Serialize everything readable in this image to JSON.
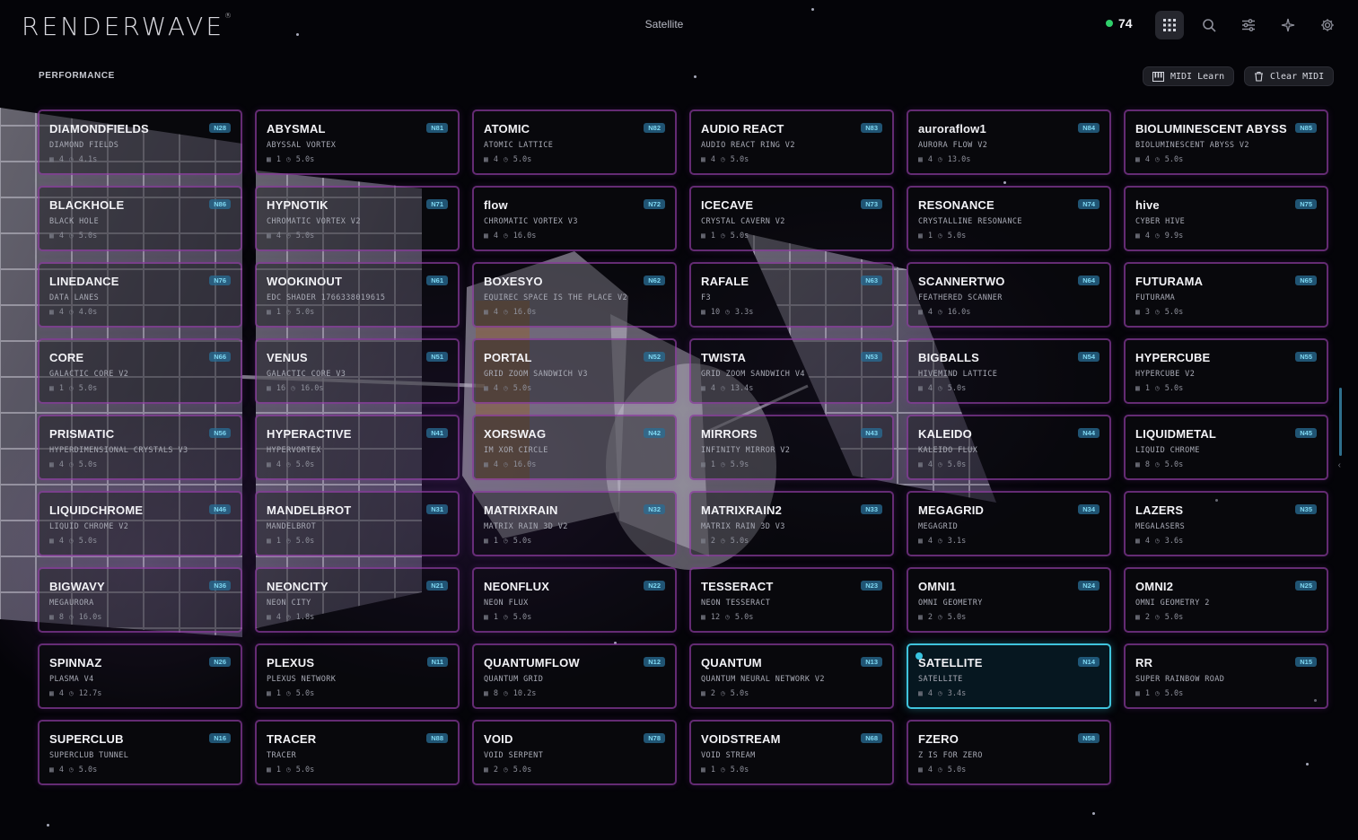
{
  "app": {
    "logo": "RENDERWAVE",
    "logo_mark": "®",
    "title": "Satellite"
  },
  "header": {
    "fps_value": "74",
    "fps_color": "#2fcf6a",
    "icons": [
      "grid-icon",
      "search-icon",
      "sliders-icon",
      "sparkle-icon",
      "gear-icon"
    ]
  },
  "performance": {
    "label": "PERFORMANCE",
    "midi_learn_label": "MIDI Learn",
    "clear_midi_label": "Clear MIDI"
  },
  "colors": {
    "card_border": "#b048c8",
    "selected_border": "#3fc3dc",
    "badge_text": "#7fd8f2"
  },
  "presets": [
    {
      "name": "DIAMONDFIELDS",
      "sub": "DIAMOND FIELDS",
      "layers": "4",
      "duration": "4.1s",
      "badge": "N28"
    },
    {
      "name": "ABYSMAL",
      "sub": "ABYSSAL VORTEX",
      "layers": "1",
      "duration": "5.0s",
      "badge": "N81"
    },
    {
      "name": "ATOMIC",
      "sub": "ATOMIC LATTICE",
      "layers": "4",
      "duration": "5.0s",
      "badge": "N82"
    },
    {
      "name": "AUDIO REACT",
      "sub": "AUDIO REACT RING V2",
      "layers": "4",
      "duration": "5.0s",
      "badge": "N83"
    },
    {
      "name": "auroraflow1",
      "sub": "AURORA FLOW V2",
      "layers": "4",
      "duration": "13.0s",
      "badge": "N84"
    },
    {
      "name": "BIOLUMINESCENT ABYSS",
      "sub": "BIOLUMINESCENT ABYSS V2",
      "layers": "4",
      "duration": "5.0s",
      "badge": "N85"
    },
    {
      "name": "BLACKHOLE",
      "sub": "BLACK HOLE",
      "layers": "4",
      "duration": "5.0s",
      "badge": "N86"
    },
    {
      "name": "HYPNOTIK",
      "sub": "CHROMATIC VORTEX V2",
      "layers": "4",
      "duration": "5.0s",
      "badge": "N71"
    },
    {
      "name": "flow",
      "sub": "CHROMATIC VORTEX V3",
      "layers": "4",
      "duration": "16.0s",
      "badge": "N72"
    },
    {
      "name": "ICECAVE",
      "sub": "CRYSTAL CAVERN V2",
      "layers": "1",
      "duration": "5.0s",
      "badge": "N73"
    },
    {
      "name": "RESONANCE",
      "sub": "CRYSTALLINE RESONANCE",
      "layers": "1",
      "duration": "5.0s",
      "badge": "N74"
    },
    {
      "name": "hive",
      "sub": "CYBER HIVE",
      "layers": "4",
      "duration": "9.9s",
      "badge": "N75"
    },
    {
      "name": "LINEDANCE",
      "sub": "DATA LANES",
      "layers": "4",
      "duration": "4.0s",
      "badge": "N76"
    },
    {
      "name": "WOOKINOUT",
      "sub": "EDC SHADER 1766338019615",
      "layers": "1",
      "duration": "5.0s",
      "badge": "N61"
    },
    {
      "name": "BOXESYO",
      "sub": "EQUIREC SPACE IS THE PLACE V2",
      "layers": "4",
      "duration": "16.0s",
      "badge": "N62"
    },
    {
      "name": "RAFALE",
      "sub": "F3",
      "layers": "10",
      "duration": "3.3s",
      "badge": "N63"
    },
    {
      "name": "SCANNERTWO",
      "sub": "FEATHERED SCANNER",
      "layers": "4",
      "duration": "16.0s",
      "badge": "N64"
    },
    {
      "name": "FUTURAMA",
      "sub": "FUTURAMA",
      "layers": "3",
      "duration": "5.0s",
      "badge": "N65"
    },
    {
      "name": "CORE",
      "sub": "GALACTIC CORE V2",
      "layers": "1",
      "duration": "5.0s",
      "badge": "N66"
    },
    {
      "name": "VENUS",
      "sub": "GALACTIC CORE V3",
      "layers": "16",
      "duration": "16.0s",
      "badge": "N51"
    },
    {
      "name": "PORTAL",
      "sub": "GRID ZOOM SANDWICH V3",
      "layers": "4",
      "duration": "5.0s",
      "badge": "N52"
    },
    {
      "name": "TWISTA",
      "sub": "GRID ZOOM SANDWICH V4",
      "layers": "4",
      "duration": "13.4s",
      "badge": "N53"
    },
    {
      "name": "BIGBALLS",
      "sub": "HIVEMIND LATTICE",
      "layers": "4",
      "duration": "5.0s",
      "badge": "N54"
    },
    {
      "name": "HYPERCUBE",
      "sub": "HYPERCUBE V2",
      "layers": "1",
      "duration": "5.0s",
      "badge": "N55"
    },
    {
      "name": "PRISMATIC",
      "sub": "HYPERDIMENSIONAL CRYSTALS V3",
      "layers": "4",
      "duration": "5.0s",
      "badge": "N56"
    },
    {
      "name": "HYPERACTIVE",
      "sub": "HYPERVORTEX",
      "layers": "4",
      "duration": "5.0s",
      "badge": "N41"
    },
    {
      "name": "XORSWAG",
      "sub": "IM XOR CIRCLE",
      "layers": "4",
      "duration": "16.0s",
      "badge": "N42"
    },
    {
      "name": "MIRRORS",
      "sub": "INFINITY MIRROR V2",
      "layers": "1",
      "duration": "5.9s",
      "badge": "N43"
    },
    {
      "name": "KALEIDO",
      "sub": "KALEIDO FLUX",
      "layers": "4",
      "duration": "5.0s",
      "badge": "N44"
    },
    {
      "name": "LIQUIDMETAL",
      "sub": "LIQUID CHROME",
      "layers": "8",
      "duration": "5.0s",
      "badge": "N45"
    },
    {
      "name": "LIQUIDCHROME",
      "sub": "LIQUID CHROME V2",
      "layers": "4",
      "duration": "5.0s",
      "badge": "N46"
    },
    {
      "name": "MANDELBROT",
      "sub": "MANDELBROT",
      "layers": "1",
      "duration": "5.0s",
      "badge": "N31"
    },
    {
      "name": "MATRIXRAIN",
      "sub": "MATRIX RAIN 3D V2",
      "layers": "1",
      "duration": "5.0s",
      "badge": "N32"
    },
    {
      "name": "MATRIXRAIN2",
      "sub": "MATRIX RAIN 3D V3",
      "layers": "2",
      "duration": "5.0s",
      "badge": "N33"
    },
    {
      "name": "MEGAGRID",
      "sub": "MEGAGRID",
      "layers": "4",
      "duration": "3.1s",
      "badge": "N34"
    },
    {
      "name": "LAZERS",
      "sub": "MEGALASERS",
      "layers": "4",
      "duration": "3.6s",
      "badge": "N35"
    },
    {
      "name": "BIGWAVY",
      "sub": "MEGAURORA",
      "layers": "8",
      "duration": "16.0s",
      "badge": "N36"
    },
    {
      "name": "NEONCITY",
      "sub": "NEON CITY",
      "layers": "4",
      "duration": "1.8s",
      "badge": "N21"
    },
    {
      "name": "NEONFLUX",
      "sub": "NEON FLUX",
      "layers": "1",
      "duration": "5.0s",
      "badge": "N22"
    },
    {
      "name": "TESSERACT",
      "sub": "NEON TESSERACT",
      "layers": "12",
      "duration": "5.0s",
      "badge": "N23"
    },
    {
      "name": "OMNI1",
      "sub": "OMNI GEOMETRY",
      "layers": "2",
      "duration": "5.0s",
      "badge": "N24"
    },
    {
      "name": "OMNI2",
      "sub": "OMNI GEOMETRY 2",
      "layers": "2",
      "duration": "5.0s",
      "badge": "N25"
    },
    {
      "name": "SPINNAZ",
      "sub": "PLASMA V4",
      "layers": "4",
      "duration": "12.7s",
      "badge": "N26"
    },
    {
      "name": "PLEXUS",
      "sub": "PLEXUS NETWORK",
      "layers": "1",
      "duration": "5.0s",
      "badge": "N11"
    },
    {
      "name": "QUANTUMFLOW",
      "sub": "QUANTUM GRID",
      "layers": "8",
      "duration": "10.2s",
      "badge": "N12"
    },
    {
      "name": "QUANTUM",
      "sub": "QUANTUM NEURAL NETWORK V2",
      "layers": "2",
      "duration": "5.0s",
      "badge": "N13"
    },
    {
      "name": "SATELLITE",
      "sub": "SATELLITE",
      "layers": "4",
      "duration": "3.4s",
      "badge": "N14",
      "selected": true
    },
    {
      "name": "RR",
      "sub": "SUPER RAINBOW ROAD",
      "layers": "1",
      "duration": "5.0s",
      "badge": "N15"
    },
    {
      "name": "SUPERCLUB",
      "sub": "SUPERCLUB TUNNEL",
      "layers": "4",
      "duration": "5.0s",
      "badge": "N16"
    },
    {
      "name": "TRACER",
      "sub": "TRACER",
      "layers": "1",
      "duration": "5.0s",
      "badge": "N88"
    },
    {
      "name": "VOID",
      "sub": "VOID SERPENT",
      "layers": "2",
      "duration": "5.0s",
      "badge": "N78"
    },
    {
      "name": "VOIDSTREAM",
      "sub": "VOID STREAM",
      "layers": "1",
      "duration": "5.0s",
      "badge": "N68"
    },
    {
      "name": "FZERO",
      "sub": "Z IS FOR ZERO",
      "layers": "4",
      "duration": "5.0s",
      "badge": "N58"
    }
  ]
}
